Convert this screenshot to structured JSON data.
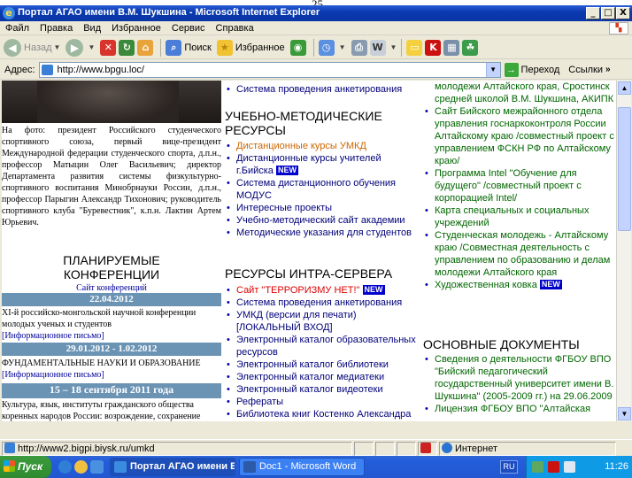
{
  "page_number": "25",
  "window": {
    "title": "Портал АГАО имени В.М. Шукшина - Microsoft Internet Explorer",
    "buttons": [
      "_",
      "□",
      "X"
    ]
  },
  "menu": [
    "Файл",
    "Правка",
    "Вид",
    "Избранное",
    "Сервис",
    "Справка"
  ],
  "toolbar": {
    "back": "Назад",
    "search": "Поиск",
    "favorites": "Избранное"
  },
  "address": {
    "label": "Адрес:",
    "url": "http://www.bpgu.loc/",
    "go": "Переход",
    "links": "Ссылки"
  },
  "left": {
    "caption": "На фото: президент Российского студенческого спортивного союза, первый вице-президент Международной федерации студенческого спорта, д.п.н., профессор Матыцин Олег Васильевич; директор Департамента развития системы физкультурно-спортивного воспитания Минобрнауки России, д.п.н., профессор Парыгин Александр Тихонович; руководитель спортивного клуба \"Буревестник\", к.п.н. Лактин Артем Юрьевич.",
    "conf_title_1": "ПЛАНИРУЕМЫЕ",
    "conf_title_2": "КОНФЕРЕНЦИИ",
    "conf_site": "Сайт конференций",
    "events": [
      {
        "date": "22.04.2012",
        "text": "XI-й российско-монгольской научной конференции молодых ученых и студентов",
        "link": "[Информационное письмо]"
      },
      {
        "date": "29.01.2012 - 1.02.2012",
        "text": "ФУНДАМЕНТАЛЬНЫЕ НАУКИ И ОБРАЗОВАНИЕ",
        "link": "[Информационное письмо]"
      },
      {
        "date": "15 – 18 сентября 2011 года",
        "text": "Культура, язык, институты гражданского общества коренных народов России: возрождение, сохранение",
        "link": ""
      }
    ]
  },
  "middle": {
    "top_items": [
      "Система проведения анкетирования"
    ],
    "section1_title_1": "УЧЕБНО-МЕТОДИЧЕСКИЕ",
    "section1_title_2": "РЕСУРСЫ",
    "section1_items": [
      "Дистанционные курсы УМКД",
      "Дистанционные курсы учителей г.Бийска",
      "Система дистанционного обучения МОДУС",
      "Интересные проекты",
      "Учебно-методический сайт академии",
      "Методические указания для студентов"
    ],
    "section2_title": "РЕСУРСЫ ИНТРА-СЕРВЕРА",
    "section2_items": [
      "Сайт \"ТЕРРОРИЗМУ НЕТ!\"",
      "Система проведения анкетирования",
      "УМКД (версии для печати) [ЛОКАЛЬНЫЙ ВХОД]",
      "Электронный каталог образовательных ресурсов",
      "Электронный каталог библиотеки",
      "Электронный каталог медиатеки",
      "Электронный каталог видеотеки",
      "Рефераты",
      "Библиотека книг Костенко Александра"
    ],
    "new_badge": "NEW"
  },
  "right": {
    "top_lines": [
      "молодежи Алтайского края, Сростинск",
      "средней школой В.М. Шукшина, АКИПК"
    ],
    "items": [
      "Сайт Бийского межрайонного отдела управления госнаркоконтроля России Алтайскому краю /совместный проект с управлением ФСКН РФ по Алтайскому краю/",
      "Программа Intel \"Обучение для будущего\" /совместный проект с корпорацией Intel/",
      "Карта специальных и социальных учреждений",
      "Студенческая молодежь - Алтайскому краю /Совместная деятельность с управлением по образованию и делам молодежи Алтайского края",
      "Художественная ковка"
    ],
    "section_title": "ОСНОВНЫЕ ДОКУМЕНТЫ",
    "doc_items": [
      "Сведения о деятельности ФГБОУ ВПО \"Бийский педагогический государственный университет имени В. Шукшина\" (2005-2009 гг.) на 29.06.2009",
      "Лицензия ФГБОУ ВПО \"Алтайская"
    ]
  },
  "status": {
    "url": "http://www2.bigpi.biysk.ru/umkd",
    "zone": "Интернет"
  },
  "taskbar": {
    "start": "Пуск",
    "tasks": [
      "Портал АГАО имени В...",
      "Doc1 - Microsoft Word"
    ],
    "lang": "RU",
    "clock": "11:26"
  }
}
